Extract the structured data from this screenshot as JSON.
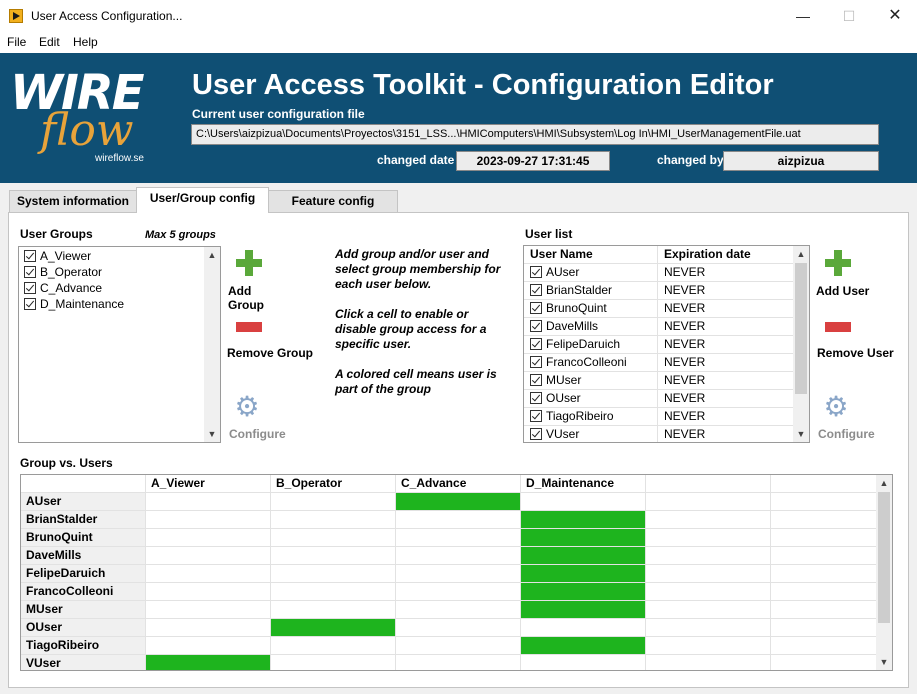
{
  "window": {
    "title": "User Access Configuration..."
  },
  "menu": [
    "File",
    "Edit",
    "Help"
  ],
  "header": {
    "logo_word_top": "WIRE",
    "logo_word_bottom": "flow",
    "logo_url": "wireflow.se",
    "title": "User Access Toolkit - Configuration Editor",
    "config_label": "Current user configuration file",
    "config_path": "C:\\Users\\aizpizua\\Documents\\Proyectos\\3151_LSS...\\HMIComputers\\HMI\\Subsystem\\Log In\\HMI_UserManagementFile.uat",
    "changed_date_label": "changed date",
    "changed_date": "2023-09-27 17:31:45",
    "changed_by_label": "changed by",
    "changed_by": "aizpizua"
  },
  "tabs": [
    "System information",
    "User/Group config",
    "Feature config"
  ],
  "active_tab": 1,
  "groups": {
    "label": "User Groups",
    "max_label": "Max 5 groups",
    "items": [
      "A_Viewer",
      "B_Operator",
      "C_Advance",
      "D_Maintenance"
    ]
  },
  "group_actions": {
    "add": "Add Group",
    "remove": "Remove Group",
    "configure": "Configure"
  },
  "instructions": [
    "Add group and/or user and select group membership for each user below.",
    "Click a cell to enable or disable group access for a specific user.",
    "A colored cell means user is part of the group"
  ],
  "users": {
    "label": "User list",
    "col_name": "User Name",
    "col_exp": "Expiration date",
    "rows": [
      {
        "name": "AUser",
        "exp": "NEVER"
      },
      {
        "name": "BrianStalder",
        "exp": "NEVER"
      },
      {
        "name": "BrunoQuint",
        "exp": "NEVER"
      },
      {
        "name": "DaveMills",
        "exp": "NEVER"
      },
      {
        "name": "FelipeDaruich",
        "exp": "NEVER"
      },
      {
        "name": "FrancoColleoni",
        "exp": "NEVER"
      },
      {
        "name": "MUser",
        "exp": "NEVER"
      },
      {
        "name": "OUser",
        "exp": "NEVER"
      },
      {
        "name": "TiagoRibeiro",
        "exp": "NEVER"
      },
      {
        "name": "VUser",
        "exp": "NEVER"
      }
    ]
  },
  "user_actions": {
    "add": "Add User",
    "remove": "Remove User",
    "configure": "Configure"
  },
  "matrix": {
    "label": "Group vs. Users",
    "columns": [
      "A_Viewer",
      "B_Operator",
      "C_Advance",
      "D_Maintenance",
      "",
      ""
    ],
    "rows": [
      {
        "user": "AUser",
        "on": [
          2
        ]
      },
      {
        "user": "BrianStalder",
        "on": [
          3
        ]
      },
      {
        "user": "BrunoQuint",
        "on": [
          3
        ]
      },
      {
        "user": "DaveMills",
        "on": [
          3
        ]
      },
      {
        "user": "FelipeDaruich",
        "on": [
          3
        ]
      },
      {
        "user": "FrancoColleoni",
        "on": [
          3
        ]
      },
      {
        "user": "MUser",
        "on": [
          3
        ]
      },
      {
        "user": "OUser",
        "on": [
          1
        ]
      },
      {
        "user": "TiagoRibeiro",
        "on": [
          3
        ]
      },
      {
        "user": "VUser",
        "on": [
          0
        ]
      }
    ],
    "member_color": "#1eb41e"
  }
}
